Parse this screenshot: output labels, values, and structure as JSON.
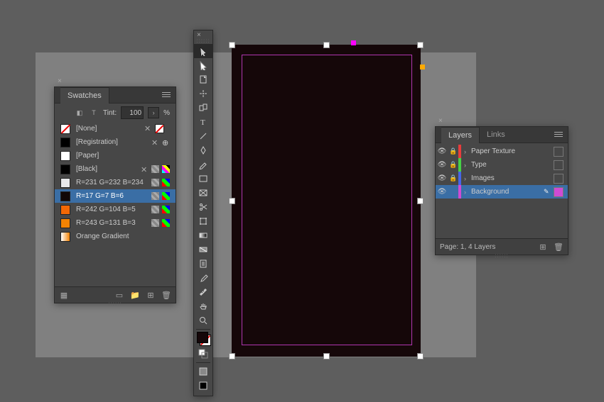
{
  "swatches_panel": {
    "title": "Swatches",
    "tint_label": "Tint:",
    "tint_value": "100",
    "tint_unit": "%",
    "items": [
      {
        "label": "[None]",
        "chipClass": "no-edit",
        "locked": true,
        "mode": "none",
        "noedit": true,
        "selected": false
      },
      {
        "label": "[Registration]",
        "chipColor": "#000",
        "locked": true,
        "mode": "reg",
        "selected": false
      },
      {
        "label": "[Paper]",
        "chipColor": "#fff",
        "selected": false
      },
      {
        "label": "[Black]",
        "chipColor": "#000",
        "locked": true,
        "mode": "cmyk",
        "selected": false
      },
      {
        "label": "R=231 G=232 B=234",
        "chipColor": "#e7e8ea",
        "mode": "rgb",
        "selected": false
      },
      {
        "label": "R=17 G=7 B=6",
        "chipColor": "#110706",
        "mode": "rgb",
        "selected": true
      },
      {
        "label": "R=242 G=104 B=5",
        "chipColor": "#f26805",
        "mode": "rgb",
        "selected": false
      },
      {
        "label": "R=243 G=131 B=3",
        "chipColor": "#f38303",
        "mode": "rgb",
        "selected": false
      },
      {
        "label": "Orange Gradient",
        "chipColor": "#f38303",
        "gradient": true,
        "selected": false
      }
    ]
  },
  "layers_panel": {
    "tabs": [
      "Layers",
      "Links"
    ],
    "active_tab": 0,
    "items": [
      {
        "name": "Paper Texture",
        "color": "#e73c3c",
        "visible": true,
        "locked": true,
        "selected": false
      },
      {
        "name": "Type",
        "color": "#46d246",
        "visible": true,
        "locked": true,
        "selected": false
      },
      {
        "name": "Images",
        "color": "#4666e7",
        "visible": true,
        "locked": true,
        "selected": false
      },
      {
        "name": "Background",
        "color": "#cf4bd4",
        "visible": true,
        "locked": false,
        "selected": true,
        "editing": true
      }
    ],
    "footer": "Page: 1, 4 Layers"
  },
  "canvas": {
    "selected_fill": "#150709"
  },
  "tool_icons": [
    "selection",
    "direct-selection",
    "page",
    "gap",
    "content-collector",
    "type",
    "line",
    "pen",
    "pencil",
    "rectangle",
    "rectangle-frame",
    "scissors",
    "free-transform",
    "gradient-swatch",
    "gradient-feather",
    "note",
    "eyedropper",
    "measure",
    "hand",
    "zoom"
  ]
}
